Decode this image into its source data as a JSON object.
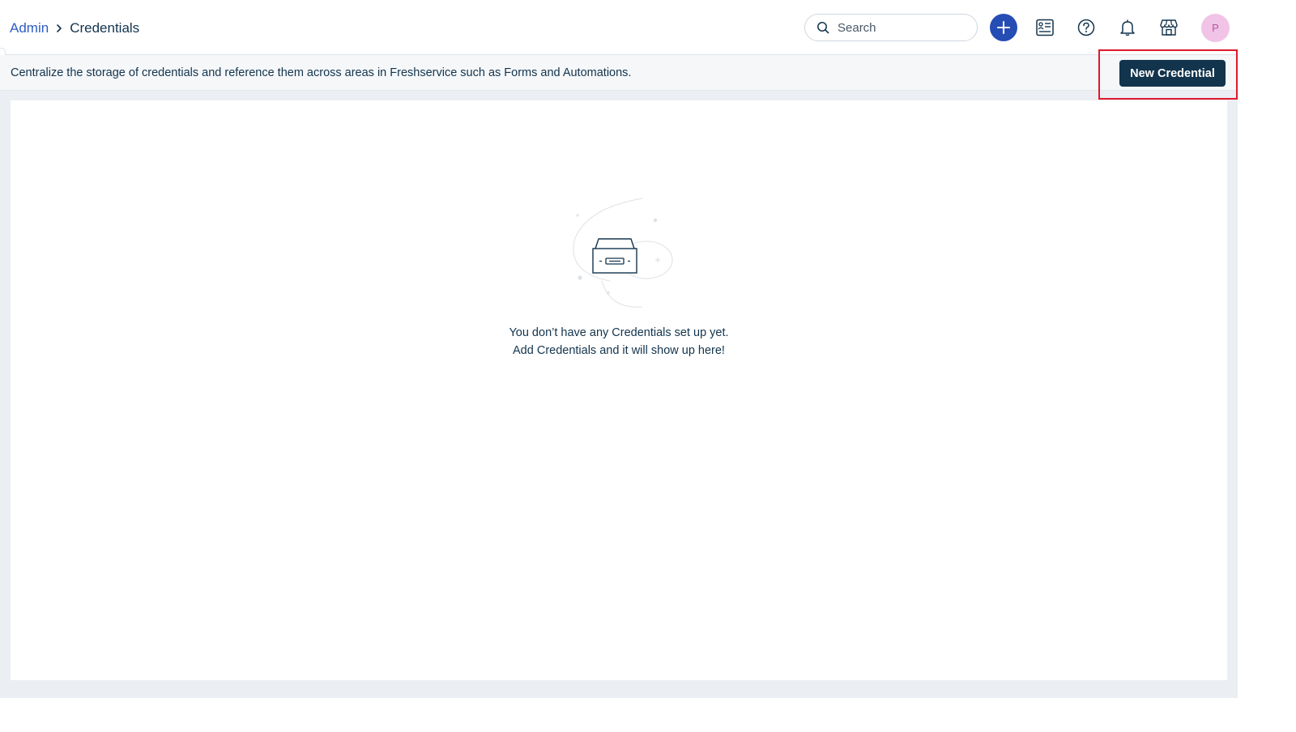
{
  "breadcrumb": {
    "parent": "Admin",
    "current": "Credentials"
  },
  "header": {
    "search_placeholder": "Search",
    "avatar_initial": "P",
    "icons": [
      "search-icon",
      "plus-icon",
      "canned-response-icon",
      "help-icon",
      "bell-icon",
      "marketplace-icon"
    ]
  },
  "subbar": {
    "description": "Centralize the storage of credentials and reference them across areas in Freshservice such as Forms and Automations.",
    "new_button_label": "New Credential"
  },
  "empty_state": {
    "line1": "You don’t have any Credentials set up yet.",
    "line2": "Add Credentials and it will show up here!"
  },
  "colors": {
    "primary": "#264db4",
    "dark_button": "#12344d",
    "highlight": "#e0182d",
    "avatar_bg": "#f1c3e6",
    "link": "#2c5cc5"
  }
}
